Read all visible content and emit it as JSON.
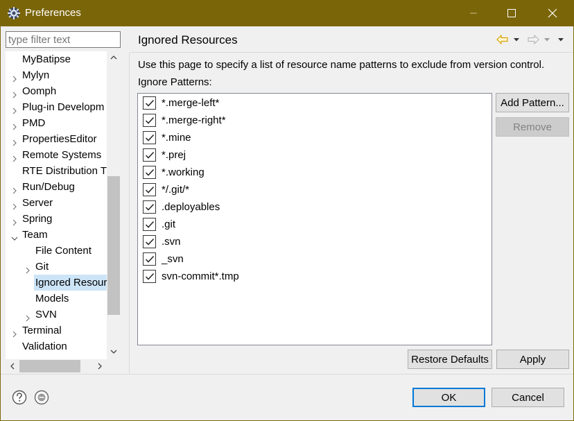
{
  "window": {
    "title": "Preferences",
    "icon": "gear-icon",
    "controls": [
      "minimize",
      "maximize",
      "close"
    ]
  },
  "filter": {
    "placeholder": "type filter text",
    "value": ""
  },
  "tree": {
    "items": [
      {
        "label": "MyBatipse",
        "expander": false,
        "level": 0
      },
      {
        "label": "Mylyn",
        "expander": true,
        "level": 0
      },
      {
        "label": "Oomph",
        "expander": true,
        "level": 0
      },
      {
        "label": "Plug-in Developm",
        "expander": true,
        "level": 0
      },
      {
        "label": "PMD",
        "expander": true,
        "level": 0
      },
      {
        "label": "PropertiesEditor",
        "expander": true,
        "level": 0
      },
      {
        "label": "Remote Systems",
        "expander": true,
        "level": 0
      },
      {
        "label": "RTE Distribution T",
        "expander": false,
        "level": 0
      },
      {
        "label": "Run/Debug",
        "expander": true,
        "level": 0
      },
      {
        "label": "Server",
        "expander": true,
        "level": 0
      },
      {
        "label": "Spring",
        "expander": true,
        "level": 0
      },
      {
        "label": "Team",
        "expander": "open",
        "level": 0
      },
      {
        "label": "File Content",
        "expander": false,
        "level": 1
      },
      {
        "label": "Git",
        "expander": true,
        "level": 1
      },
      {
        "label": "Ignored Resour",
        "expander": false,
        "level": 1,
        "selected": true
      },
      {
        "label": "Models",
        "expander": false,
        "level": 1
      },
      {
        "label": "SVN",
        "expander": true,
        "level": 1
      },
      {
        "label": "Terminal",
        "expander": true,
        "level": 0
      },
      {
        "label": "Validation",
        "expander": false,
        "level": 0
      }
    ]
  },
  "page": {
    "title": "Ignored Resources",
    "description": "Use this page to specify a list of resource name patterns to exclude from version control.",
    "patterns_label": "Ignore Patterns:",
    "patterns": [
      {
        "text": "*.merge-left*",
        "checked": true
      },
      {
        "text": "*.merge-right*",
        "checked": true
      },
      {
        "text": "*.mine",
        "checked": true
      },
      {
        "text": "*.prej",
        "checked": true
      },
      {
        "text": "*.working",
        "checked": true
      },
      {
        "text": "*/.git/*",
        "checked": true
      },
      {
        "text": ".deployables",
        "checked": true
      },
      {
        "text": ".git",
        "checked": true
      },
      {
        "text": ".svn",
        "checked": true
      },
      {
        "text": "_svn",
        "checked": true
      },
      {
        "text": "svn-commit*.tmp",
        "checked": true
      }
    ],
    "add_pattern_label": "Add Pattern...",
    "remove_label": "Remove",
    "restore_defaults_label": "Restore Defaults",
    "apply_label": "Apply"
  },
  "footer": {
    "ok_label": "OK",
    "cancel_label": "Cancel"
  },
  "colors": {
    "titlebar": "#7a6508",
    "selection": "#cce4f7",
    "default_button_border": "#0078d7",
    "nav_arrow_active": "#d9a400"
  }
}
